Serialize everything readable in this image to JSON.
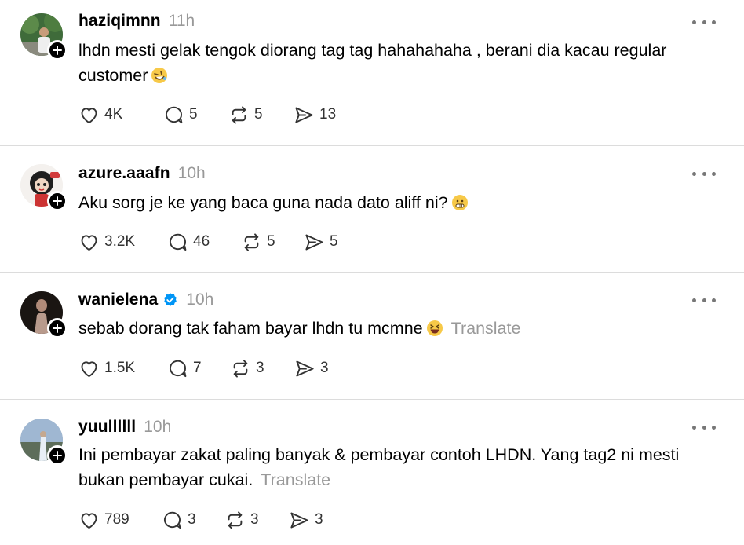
{
  "posts": [
    {
      "username": "haziqimnn",
      "time": "11h",
      "verified": false,
      "text": "lhdn mesti gelak tengok diorang tag tag hahahahaha , berani dia kacau regular customer",
      "emoji": "rofl-emoji",
      "translate": "",
      "likes": "4K",
      "replies": "5",
      "reposts": "5",
      "shares": "13"
    },
    {
      "username": "azure.aaafn",
      "time": "10h",
      "verified": false,
      "text": "Aku sorg je ke yang baca guna nada dato aliff ni?",
      "emoji": "grimace-emoji",
      "translate": "",
      "likes": "3.2K",
      "replies": "46",
      "reposts": "5",
      "shares": "5"
    },
    {
      "username": "wanielena",
      "time": "10h",
      "verified": true,
      "text": "sebab dorang tak faham bayar lhdn tu mcmne",
      "emoji": "laughing-emoji",
      "translate": "Translate",
      "likes": "1.5K",
      "replies": "7",
      "reposts": "3",
      "shares": "3"
    },
    {
      "username": "yuullllll",
      "time": "10h",
      "verified": false,
      "text": "Ini pembayar zakat paling banyak & pembayar contoh LHDN. Yang tag2 ni mesti bukan pembayar cukai.",
      "emoji": "",
      "translate": "Translate",
      "likes": "789",
      "replies": "3",
      "reposts": "3",
      "shares": "3"
    }
  ],
  "colors": {
    "text": "#000000",
    "muted": "#999999",
    "icon": "#333333",
    "divider": "#dcdcdc",
    "verified": "#0095f6"
  }
}
